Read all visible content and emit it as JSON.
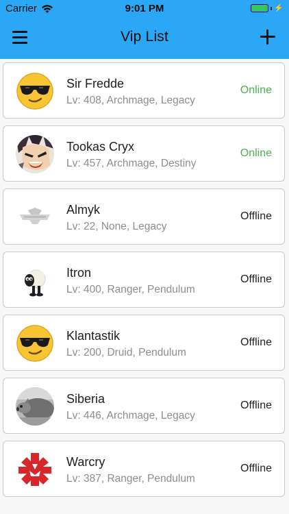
{
  "status_bar": {
    "carrier": "Carrier",
    "time": "9:01 PM",
    "battery_level": 1.0
  },
  "nav": {
    "title": "Vip List"
  },
  "colors": {
    "header": "#2aa8f6",
    "online": "#4caf50",
    "offline": "#1e1e1e"
  },
  "players": [
    {
      "name": "Sir Fredde",
      "details": "Lv: 408, Archmage, Legacy",
      "status": "Online",
      "avatar": "sunglasses-emoji-avatar"
    },
    {
      "name": "Tookas Cryx",
      "details": "Lv: 457, Archmage, Destiny",
      "status": "Online",
      "avatar": "anime-warrior-avatar"
    },
    {
      "name": "Almyk",
      "details": "Lv: 22, None, Legacy",
      "status": "Offline",
      "avatar": "grey-logo-avatar"
    },
    {
      "name": "Itron",
      "details": "Lv: 400, Ranger, Pendulum",
      "status": "Offline",
      "avatar": "sheep-avatar"
    },
    {
      "name": "Klantastik",
      "details": "Lv: 200, Druid, Pendulum",
      "status": "Offline",
      "avatar": "sunglasses-emoji-avatar"
    },
    {
      "name": "Siberia",
      "details": "Lv: 446, Archmage, Legacy",
      "status": "Offline",
      "avatar": "animal-photo-avatar"
    },
    {
      "name": "Warcry",
      "details": "Lv: 387, Ranger, Pendulum",
      "status": "Offline",
      "avatar": "red-emblem-avatar"
    }
  ]
}
